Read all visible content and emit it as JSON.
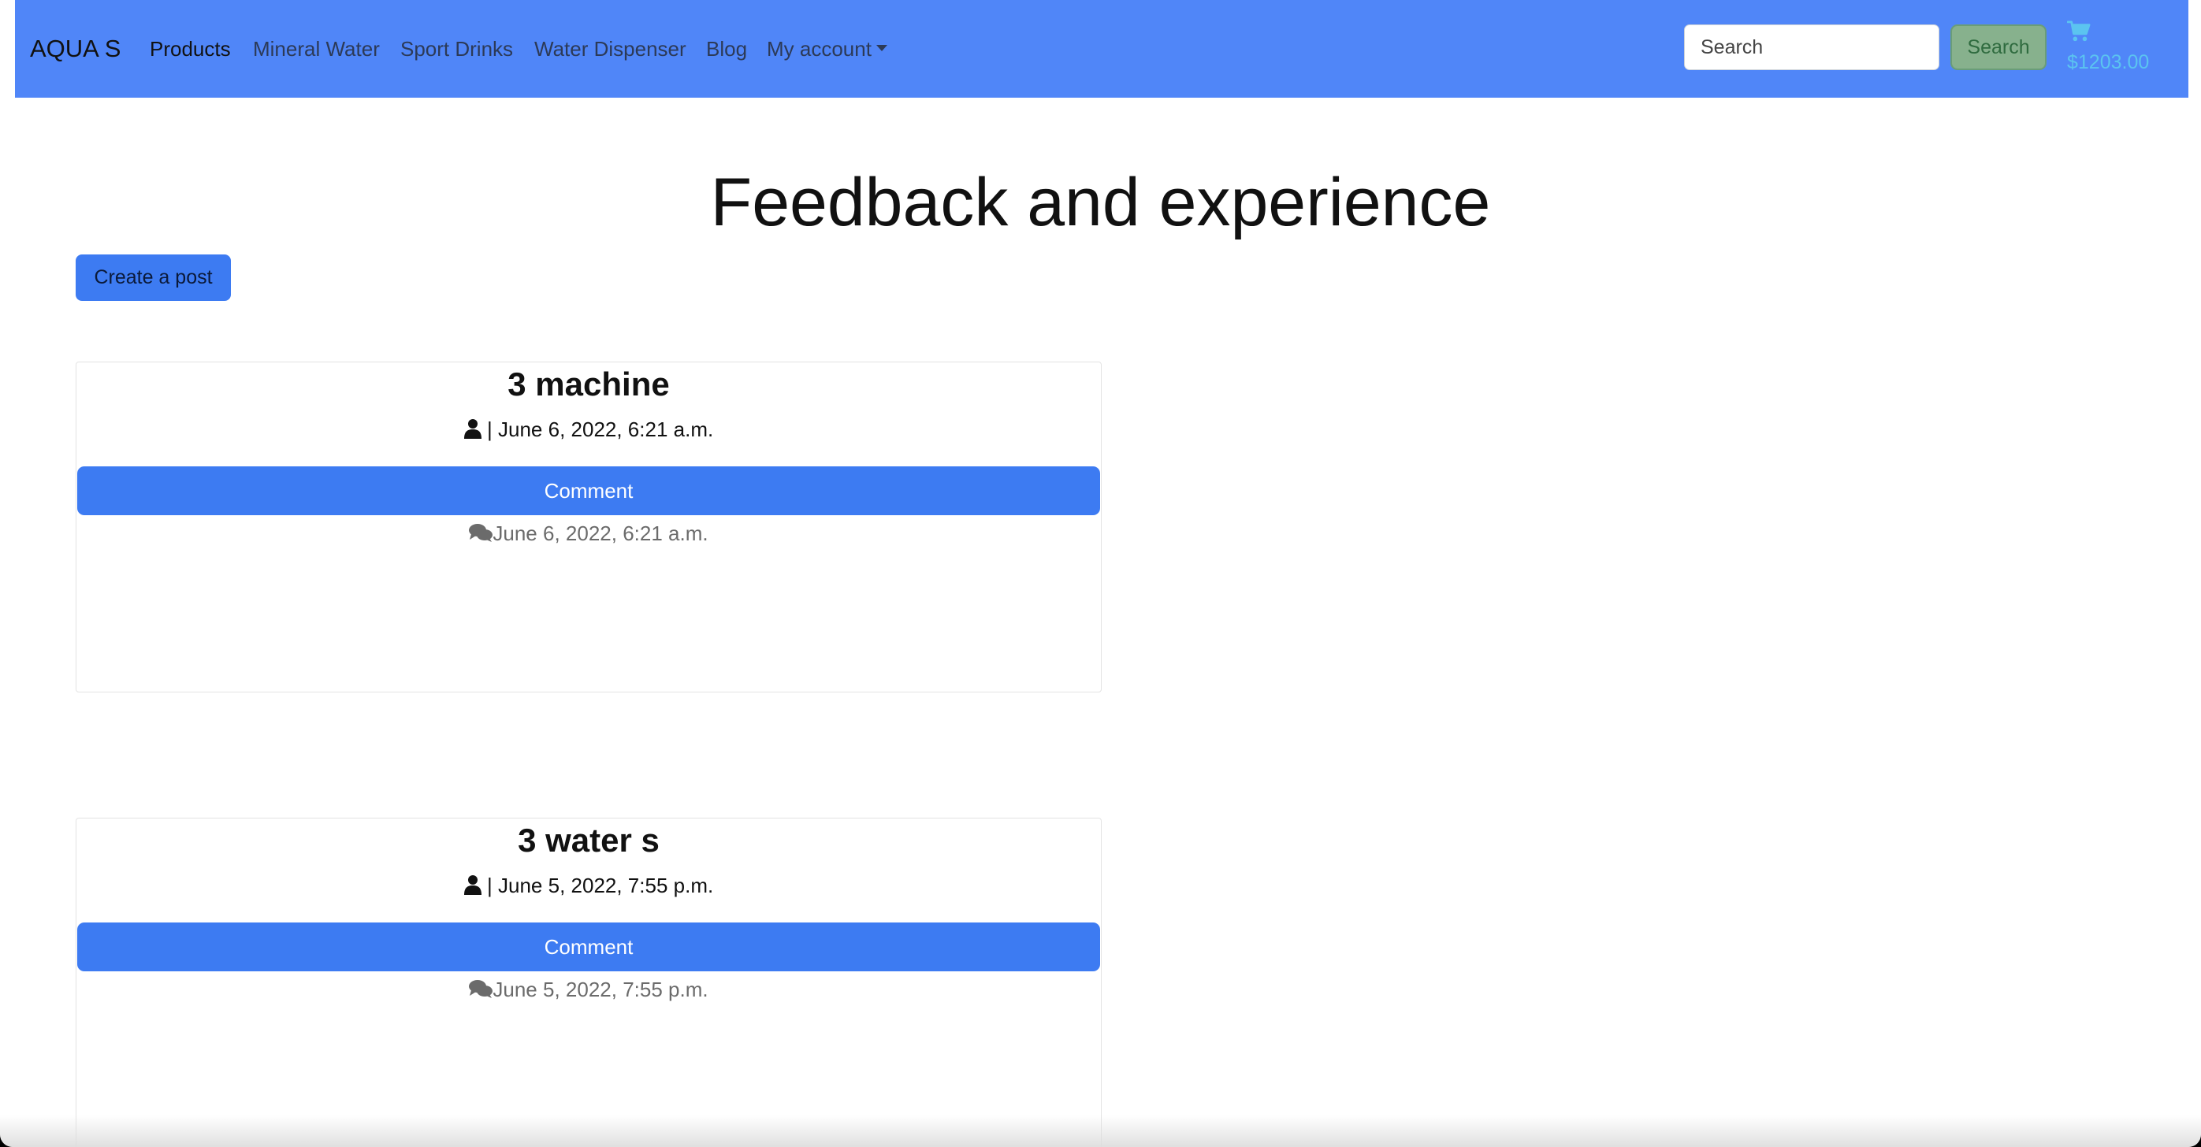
{
  "navbar": {
    "brand": "AQUA S",
    "links": [
      {
        "label": "Products"
      },
      {
        "label": "Mineral Water"
      },
      {
        "label": "Sport Drinks"
      },
      {
        "label": "Water Dispenser"
      },
      {
        "label": "Blog"
      },
      {
        "label": "My account"
      }
    ],
    "search_placeholder": "Search",
    "search_button": "Search",
    "cart_total": "$1203.00",
    "cart_icon": "shopping-cart-icon"
  },
  "main": {
    "title": "Feedback and experience",
    "create_post_label": "Create a post"
  },
  "posts": [
    {
      "title": "3 machine",
      "meta": "| June 6, 2022, 6:21 a.m.",
      "comment_label": "Comment",
      "comment_date": "June 6, 2022, 6:21 a.m."
    },
    {
      "title": "3 water s",
      "meta": "| June 5, 2022, 7:55 p.m.",
      "comment_label": "Comment",
      "comment_date": "June 5, 2022, 7:55 p.m."
    }
  ],
  "colors": {
    "navbar_bg": "#5086f8",
    "primary_button": "#3d7bf2",
    "search_button_bg": "#87b18d",
    "cart_accent": "#5bc4f0"
  }
}
